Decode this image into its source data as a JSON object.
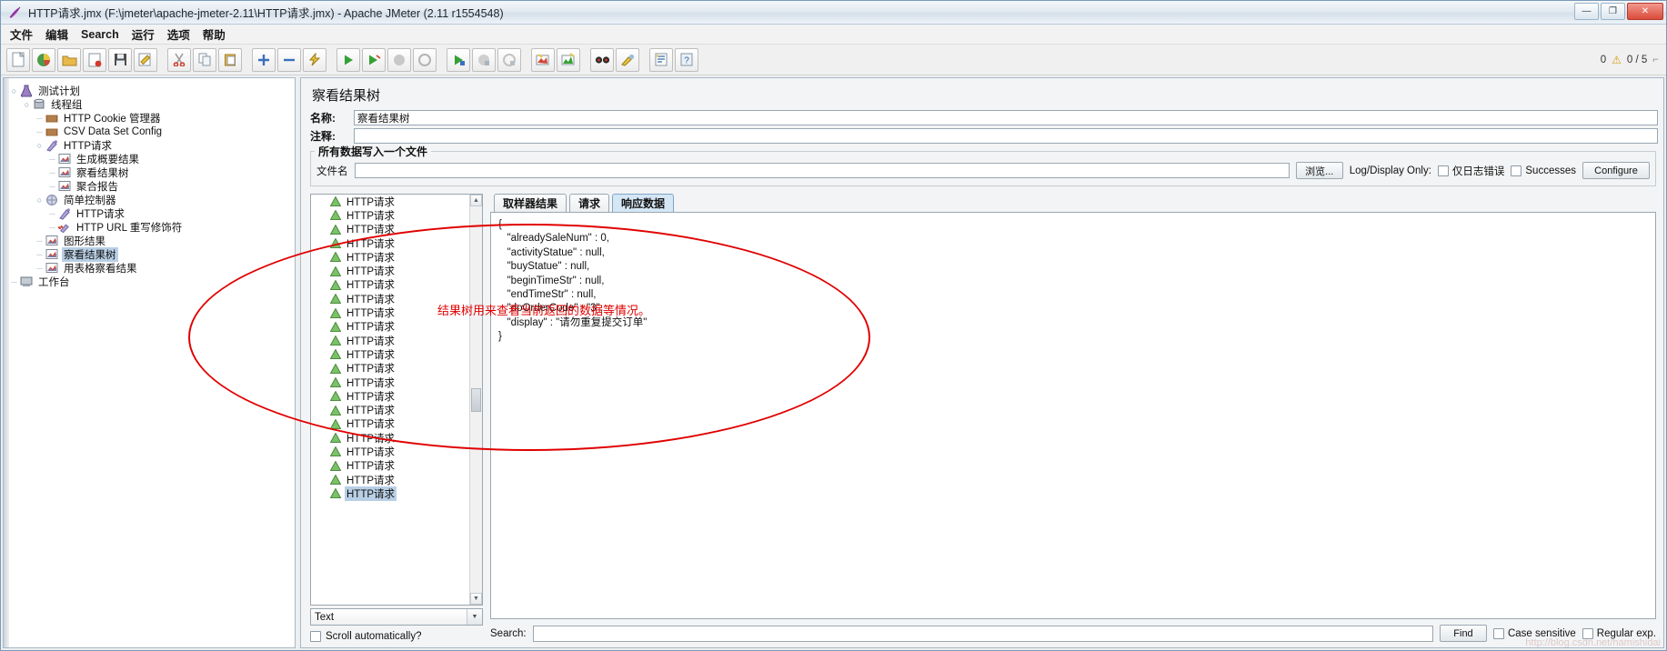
{
  "window": {
    "title": "HTTP请求.jmx (F:\\jmeter\\apache-jmeter-2.11\\HTTP请求.jmx) - Apache JMeter (2.11 r1554548)",
    "icon": "jmeter-feather-icon",
    "buttons": {
      "minimize": "—",
      "maximize": "❐",
      "close": "✕"
    }
  },
  "menubar": {
    "items": [
      {
        "label": "文件"
      },
      {
        "label": "编辑"
      },
      {
        "label": "Search"
      },
      {
        "label": "运行"
      },
      {
        "label": "选项"
      },
      {
        "label": "帮助"
      }
    ]
  },
  "toolbar": {
    "buttons": [
      {
        "name": "new-icon"
      },
      {
        "name": "templates-icon"
      },
      {
        "name": "open-icon"
      },
      {
        "name": "close-icon"
      },
      {
        "name": "save-icon"
      },
      {
        "name": "save-as-icon"
      },
      {
        "name": "cut-icon"
      },
      {
        "name": "copy-icon"
      },
      {
        "name": "paste-icon"
      },
      {
        "name": "expand-all-icon"
      },
      {
        "name": "collapse-all-icon"
      },
      {
        "name": "toggle-icon"
      },
      {
        "name": "start-icon"
      },
      {
        "name": "start-no-pause-icon"
      },
      {
        "name": "stop-icon"
      },
      {
        "name": "shutdown-icon"
      },
      {
        "name": "remote-start-all-icon"
      },
      {
        "name": "remote-stop-all-icon"
      },
      {
        "name": "remote-shutdown-all-icon"
      },
      {
        "name": "clear-icon"
      },
      {
        "name": "clear-all-icon"
      },
      {
        "name": "search-icon"
      },
      {
        "name": "search-reset-icon"
      },
      {
        "name": "function-helper-icon"
      },
      {
        "name": "help-icon"
      }
    ],
    "status": {
      "warnings_count": "0",
      "warning_icon": "warning-triangle-icon",
      "threads_count": "0 / 5"
    }
  },
  "tree": {
    "items": [
      {
        "label": "测试计划",
        "depth": 0,
        "icon": "test-plan-icon",
        "expanded": true,
        "selected": false
      },
      {
        "label": "线程组",
        "depth": 1,
        "icon": "thread-group-icon",
        "expanded": true,
        "selected": false
      },
      {
        "label": "HTTP Cookie 管理器",
        "depth": 2,
        "icon": "cookie-manager-icon",
        "expanded": null,
        "selected": false
      },
      {
        "label": "CSV Data Set Config",
        "depth": 2,
        "icon": "csv-data-set-icon",
        "expanded": null,
        "selected": false
      },
      {
        "label": "HTTP请求",
        "depth": 2,
        "icon": "http-request-icon",
        "expanded": true,
        "selected": false
      },
      {
        "label": "生成概要结果",
        "depth": 3,
        "icon": "listener-icon",
        "expanded": null,
        "selected": false
      },
      {
        "label": "察看结果树",
        "depth": 3,
        "icon": "listener-icon",
        "expanded": null,
        "selected": false
      },
      {
        "label": "聚合报告",
        "depth": 3,
        "icon": "listener-icon",
        "expanded": null,
        "selected": false
      },
      {
        "label": "简单控制器",
        "depth": 2,
        "icon": "simple-controller-icon",
        "expanded": true,
        "selected": false
      },
      {
        "label": "HTTP请求",
        "depth": 3,
        "icon": "http-request-icon",
        "expanded": null,
        "selected": false
      },
      {
        "label": "HTTP URL 重写修饰符",
        "depth": 3,
        "icon": "url-rewriting-icon",
        "expanded": null,
        "selected": false
      },
      {
        "label": "图形结果",
        "depth": 2,
        "icon": "listener-icon",
        "expanded": null,
        "selected": false
      },
      {
        "label": "察看结果树",
        "depth": 2,
        "icon": "listener-icon",
        "expanded": null,
        "selected": true
      },
      {
        "label": "用表格察看结果",
        "depth": 2,
        "icon": "listener-icon",
        "expanded": null,
        "selected": false
      },
      {
        "label": "工作台",
        "depth": 0,
        "icon": "workbench-icon",
        "expanded": null,
        "selected": false
      }
    ]
  },
  "panel": {
    "title": "察看结果树",
    "name_label": "名称:",
    "name_value": "察看结果树",
    "comment_label": "注释:",
    "comment_value": "",
    "file_group_caption": "所有数据写入一个文件",
    "filename_label": "文件名",
    "filename_value": "",
    "browse_button": "浏览...",
    "log_display_label": "Log/Display Only:",
    "errors_checkbox": "仅日志错误",
    "successes_checkbox": "Successes",
    "configure_button": "Configure"
  },
  "samples": {
    "rows": [
      {
        "label": "HTTP请求",
        "selected": false
      },
      {
        "label": "HTTP请求",
        "selected": false
      },
      {
        "label": "HTTP请求",
        "selected": false
      },
      {
        "label": "HTTP请求",
        "selected": false
      },
      {
        "label": "HTTP请求",
        "selected": false
      },
      {
        "label": "HTTP请求",
        "selected": false
      },
      {
        "label": "HTTP请求",
        "selected": false
      },
      {
        "label": "HTTP请求",
        "selected": false
      },
      {
        "label": "HTTP请求",
        "selected": false
      },
      {
        "label": "HTTP请求",
        "selected": false
      },
      {
        "label": "HTTP请求",
        "selected": false
      },
      {
        "label": "HTTP请求",
        "selected": false
      },
      {
        "label": "HTTP请求",
        "selected": false
      },
      {
        "label": "HTTP请求",
        "selected": false
      },
      {
        "label": "HTTP请求",
        "selected": false
      },
      {
        "label": "HTTP请求",
        "selected": false
      },
      {
        "label": "HTTP请求",
        "selected": false
      },
      {
        "label": "HTTP请求",
        "selected": false
      },
      {
        "label": "HTTP请求",
        "selected": false
      },
      {
        "label": "HTTP请求",
        "selected": false
      },
      {
        "label": "HTTP请求",
        "selected": false
      },
      {
        "label": "HTTP请求",
        "selected": true
      }
    ],
    "render_combo_value": "Text",
    "scroll_automatically_label": "Scroll automatically?"
  },
  "result_tabs": [
    {
      "label": "取样器结果",
      "active": false
    },
    {
      "label": "请求",
      "active": false
    },
    {
      "label": "响应数据",
      "active": true
    }
  ],
  "response_data": "{\n   \"alreadySaleNum\" : 0,\n   \"activityStatue\" : null,\n   \"buyStatue\" : null,\n   \"beginTimeStr\" : null,\n   \"endTimeStr\" : null,\n   \"doOrderCode\" : \"3\",\n   \"display\" : \"请勿重复提交订单\"\n}",
  "search_bar": {
    "label": "Search:",
    "value": "",
    "find_button": "Find",
    "case_sensitive_label": "Case sensitive",
    "regular_exp_label": "Regular exp."
  },
  "annotation": {
    "text": "结果树用来查看当前返回的数据等情况。",
    "color": "#e00000",
    "shape": "ellipse"
  },
  "watermark": "http://blog.csdn.net/hamishidai"
}
